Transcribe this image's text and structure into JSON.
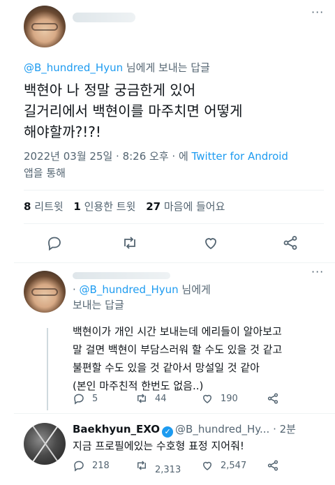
{
  "main_tweet": {
    "more_icon": "more-dots-icon",
    "reply_to_handle": "@B_hundred_Hyun",
    "reply_to_suffix": " 님에게 보내는 답글",
    "text_lines": [
      "백현아 나 정말 궁금한게 있어",
      "길거리에서 백현이를 마주치면 어떻게",
      "해야할까?!?!"
    ],
    "timestamp": "2022년 03월 25일 · 8:26 오후 · 에 ",
    "source": "Twitter for Android",
    "source_suffix": "앱을 통해",
    "stats": {
      "retweets_count": "8",
      "retweets_label": "리트윗",
      "quotes_count": "1",
      "quotes_label": "인용한 트윗",
      "likes_count": "27",
      "likes_label": "마음에 들어요"
    }
  },
  "reply_tweet": {
    "reply_to_handle": "@B_hundred_Hyun",
    "reply_to_suffix": " 님에게",
    "reply_to_suffix2": "보내는 답글",
    "text_lines": [
      "백현이가 개인 시간 보내는데 에리들이 알아보고",
      "말 걸면 백현이 부담스러워 할 수도 있을 것 같고",
      "불편할 수도 있을 것 같아서 망설일 것 같아",
      "(본인 마주친적 한번도 없음..)"
    ],
    "replies": "5",
    "retweets": "44",
    "likes": "190"
  },
  "exo_tweet": {
    "display_name": "Baekhyun_EXO",
    "handle": "@B_hundred_Hy...",
    "time": "· 2분",
    "text": "지금 프로필에있는 수호형 표정 지어줘!",
    "replies": "218",
    "retweets": "2,313",
    "likes": "2,547"
  },
  "colors": {
    "accent": "#1d9bf0",
    "muted": "#536471",
    "text": "#0f1419",
    "divider": "#eff3f4"
  }
}
